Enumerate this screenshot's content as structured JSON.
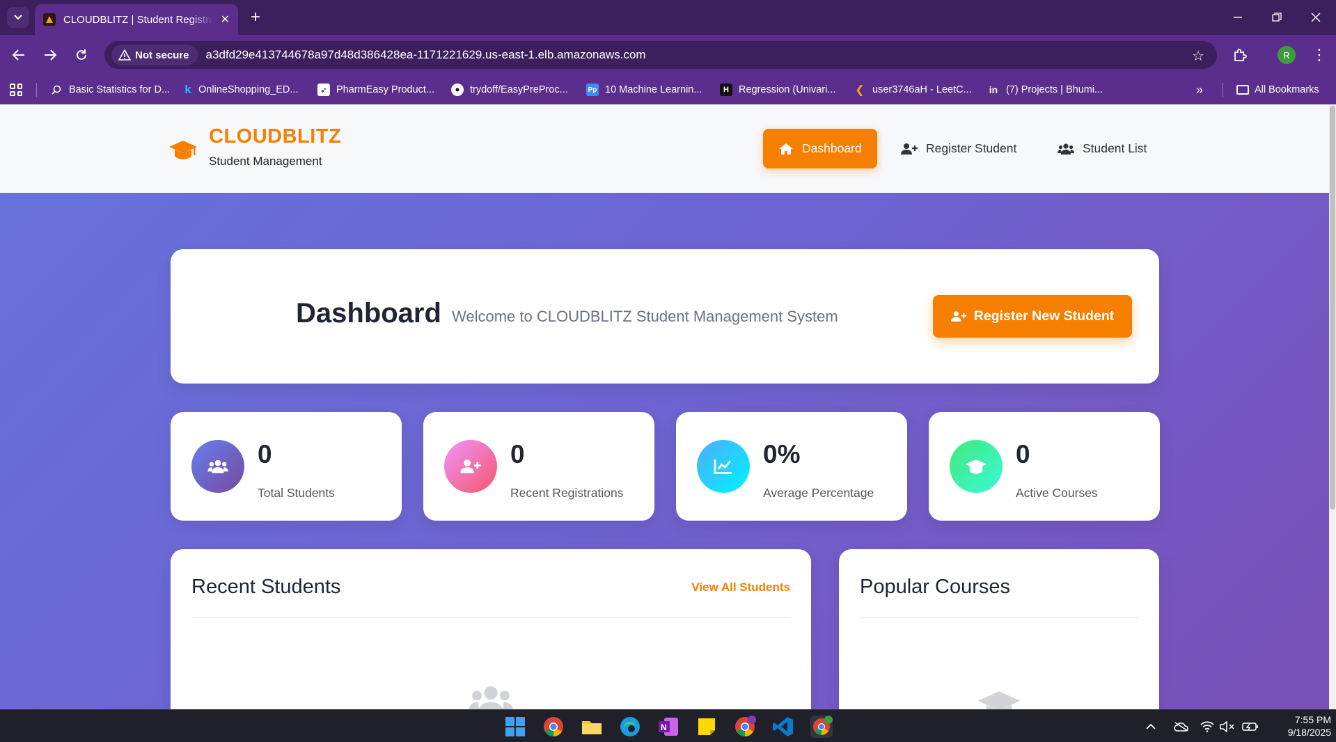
{
  "browser": {
    "tab_title": "CLOUDBLITZ | Student Registration",
    "not_secure_label": "Not secure",
    "url": "a3dfd29e413744678a97d48d386428ea-1171221629.us-east-1.elb.amazonaws.com",
    "profile_initial": "R",
    "bookmarks": [
      {
        "label": "Basic Statistics for D...",
        "icon": "search-icon"
      },
      {
        "label": "OnlineShopping_ED...",
        "icon": "k-icon"
      },
      {
        "label": "PharmEasy Product...",
        "icon": "rocket-icon"
      },
      {
        "label": "trydoff/EasyPreProc...",
        "icon": "github-icon"
      },
      {
        "label": "10 Machine Learnin...",
        "icon": "pp-icon"
      },
      {
        "label": "Regression (Univari...",
        "icon": "h-icon"
      },
      {
        "label": "user3746aH - LeetC...",
        "icon": "leetcode-icon"
      },
      {
        "label": "(7) Projects | Bhumi...",
        "icon": "linkedin-icon"
      }
    ],
    "all_bookmarks_label": "All Bookmarks"
  },
  "header": {
    "brand_name": "CLOUDBLITZ",
    "brand_sub": "Student Management",
    "nav": [
      {
        "label": "Dashboard",
        "icon": "home-icon",
        "active": true
      },
      {
        "label": "Register Student",
        "icon": "user-plus-icon",
        "active": false
      },
      {
        "label": "Student List",
        "icon": "users-icon",
        "active": false
      }
    ]
  },
  "hero": {
    "title": "Dashboard",
    "subtitle": "Welcome to CLOUDBLITZ Student Management System",
    "button_label": "Register New Student"
  },
  "stats": [
    {
      "value": "0",
      "label": "Total Students",
      "icon": "users-icon",
      "color_from": "#667eea",
      "color_to": "#764ba2"
    },
    {
      "value": "0",
      "label": "Recent Registrations",
      "icon": "user-plus-icon",
      "color_from": "#f093fb",
      "color_to": "#f5576c"
    },
    {
      "value": "0%",
      "label": "Average Percentage",
      "icon": "chart-line-icon",
      "color_from": "#4facfe",
      "color_to": "#00f2fe"
    },
    {
      "value": "0",
      "label": "Active Courses",
      "icon": "graduation-cap-icon",
      "color_from": "#43e97b",
      "color_to": "#38f9d7"
    }
  ],
  "recent_students": {
    "title": "Recent Students",
    "link_label": "View All Students"
  },
  "popular_courses": {
    "title": "Popular Courses"
  },
  "taskbar": {
    "time": "7:55 PM",
    "date": "9/18/2025"
  },
  "colors": {
    "accent": "#f77f00",
    "browser_frame": "#5b2d8c"
  }
}
